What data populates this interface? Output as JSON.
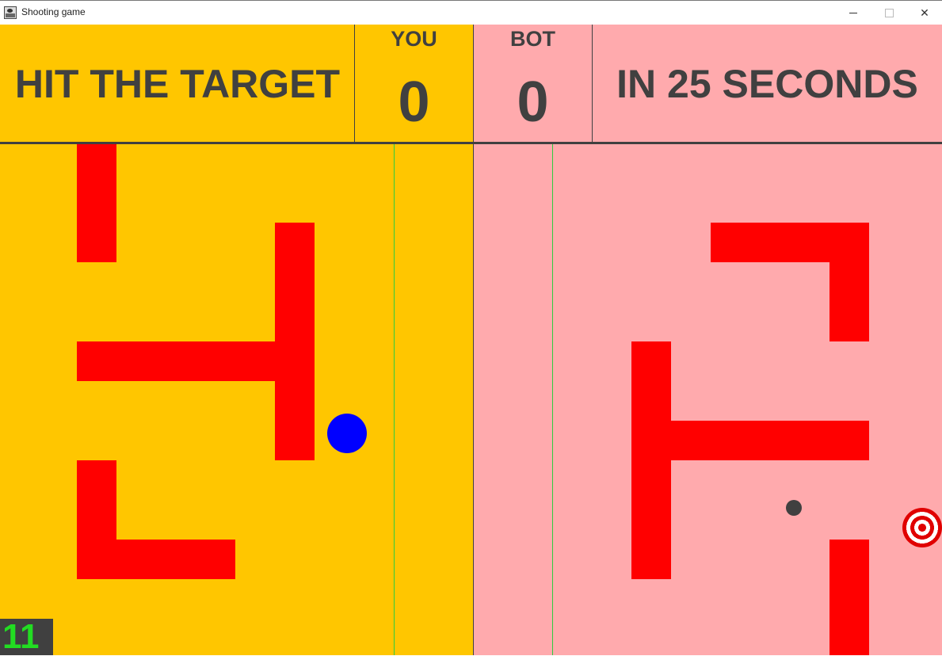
{
  "window": {
    "title": "Shooting game",
    "icon": "app-icon",
    "controls": {
      "minimize": "minimize-icon",
      "maximize": "maximize-icon",
      "close": "✕"
    }
  },
  "hud": {
    "left_message": "HIT THE TARGET",
    "right_message": "IN 25 SECONDS",
    "you_label": "YOU",
    "bot_label": "BOT",
    "you_score": "0",
    "bot_score": "0"
  },
  "timer": "11",
  "colors": {
    "player_side": "#FFC600",
    "bot_side": "#FFAAAD",
    "walls": "#FF0000",
    "player": "#0000FF",
    "bot": "#404040",
    "guide_lines": "#2ECC40",
    "text": "#404040",
    "timer_text": "#22DD22"
  },
  "entities": {
    "player": "blue-ball",
    "bot": "dark-ball",
    "target": "bullseye-target-icon"
  }
}
